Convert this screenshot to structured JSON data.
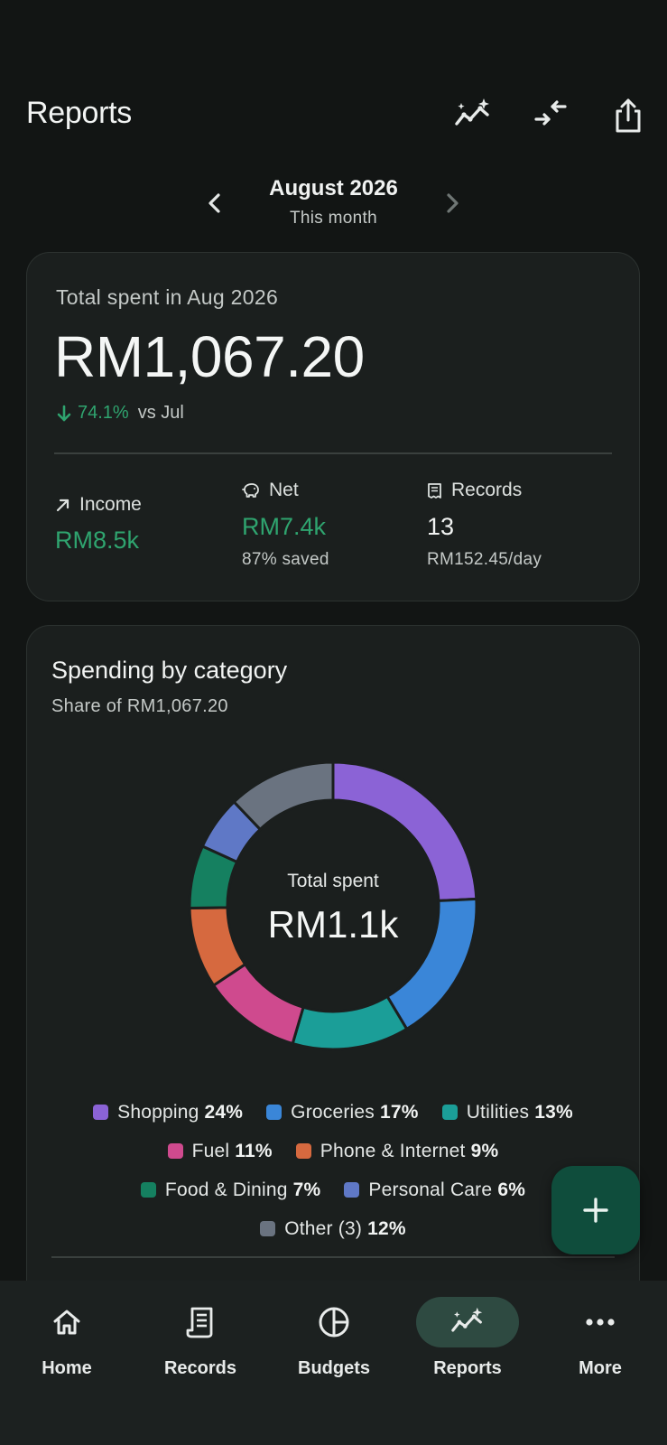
{
  "header": {
    "title": "Reports",
    "icons": [
      "insights-sparkle-icon",
      "compare-arrows-icon",
      "share-icon"
    ]
  },
  "period": {
    "month": "August 2026",
    "subtitle": "This month"
  },
  "summary": {
    "label": "Total spent in Aug 2026",
    "total": "RM1,067.20",
    "change_pct": "74.1%",
    "change_direction": "down",
    "change_vs": "vs Jul",
    "income": {
      "label": "Income",
      "value": "RM8.5k",
      "icon": "arrow-up-right-icon"
    },
    "net": {
      "label": "Net",
      "value": "RM7.4k",
      "sub": "87% saved",
      "icon": "piggy-bank-icon"
    },
    "records": {
      "label": "Records",
      "value": "13",
      "sub": "RM152.45/day",
      "icon": "receipt-icon"
    }
  },
  "category": {
    "title": "Spending by category",
    "subtitle": "Share of RM1,067.20",
    "center_label": "Total spent",
    "center_value": "RM1.1k"
  },
  "chart_data": {
    "type": "pie",
    "variant": "donut",
    "categories": [
      "Shopping",
      "Groceries",
      "Utilities",
      "Fuel",
      "Phone & Internet",
      "Food & Dining",
      "Personal Care",
      "Other (3)"
    ],
    "values": [
      24,
      17,
      13,
      11,
      9,
      7,
      6,
      12
    ],
    "labels": [
      "24%",
      "17%",
      "13%",
      "11%",
      "9%",
      "7%",
      "6%",
      "12%"
    ],
    "colors": [
      "#8b63d6",
      "#3a86d8",
      "#1b9e98",
      "#cf4a8e",
      "#d6693f",
      "#158060",
      "#5f78c6",
      "#6a7380"
    ],
    "legend_position": "bottom"
  },
  "nav": {
    "items": [
      {
        "label": "Home",
        "icon": "home-icon"
      },
      {
        "label": "Records",
        "icon": "receipt-icon"
      },
      {
        "label": "Budgets",
        "icon": "pie-icon"
      },
      {
        "label": "Reports",
        "icon": "insights-sparkle-icon",
        "active": true
      },
      {
        "label": "More",
        "icon": "more-dots-icon"
      }
    ]
  },
  "fab": {
    "icon": "plus-icon"
  }
}
